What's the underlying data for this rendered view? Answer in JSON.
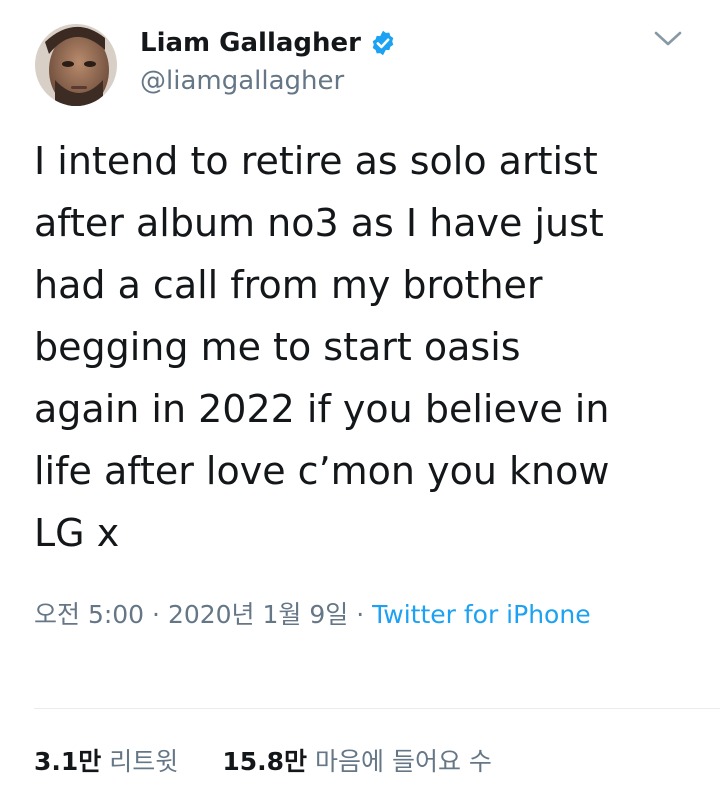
{
  "author": {
    "display_name": "Liam Gallagher",
    "handle": "@liamgallagher",
    "verified": true,
    "avatar_icon": "profile-photo"
  },
  "menu_icon": "chevron-down-icon",
  "tweet": {
    "lines": [
      "I intend to retire as solo artist",
      "after album no3 as I have just",
      "had a call from my brother",
      "begging me to start oasis",
      "again in 2022 if you believe in",
      "life after love c’mon you know",
      "LG x"
    ]
  },
  "meta": {
    "time": "오전 5:00",
    "separator": " · ",
    "date": "2020년 1월 9일",
    "source": "Twitter for iPhone"
  },
  "stats": {
    "retweets_count": "3.1만",
    "retweets_label": "리트윗",
    "likes_count": "15.8만",
    "likes_label": "마음에 들어요 수"
  },
  "colors": {
    "text": "#14171a",
    "secondary": "#657786",
    "accent": "#1da1f2",
    "divider": "#e6ecf0"
  }
}
